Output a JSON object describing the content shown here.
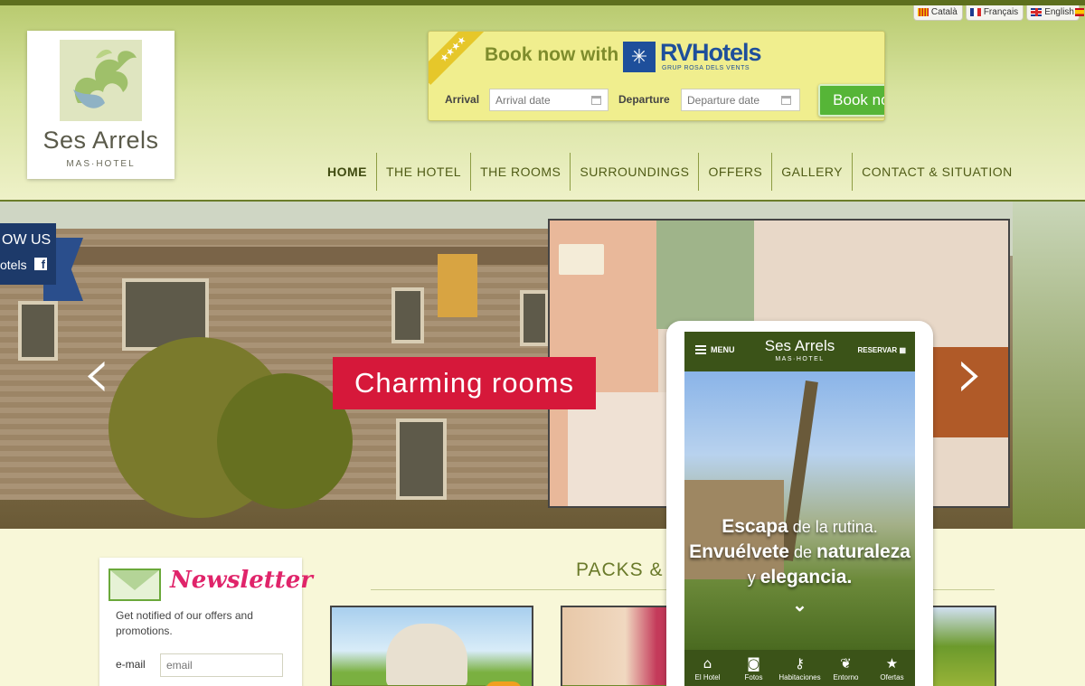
{
  "languages": [
    {
      "label": "Català",
      "flag": "ca"
    },
    {
      "label": "Français",
      "flag": "fr"
    },
    {
      "label": "English",
      "flag": "en"
    }
  ],
  "logo": {
    "name": "Ses Arrels",
    "subtitle": "MAS·HOTEL"
  },
  "booking": {
    "ribbon_stars": "★★★★",
    "title": "Book now with",
    "brand": "RVHotels",
    "brand_tagline": "GRUP ROSA DELS VENTS",
    "arrival_label": "Arrival",
    "arrival_placeholder": "Arrival date",
    "departure_label": "Departure",
    "departure_placeholder": "Departure date",
    "button": "Book now"
  },
  "nav": {
    "items": [
      {
        "label": "HOME",
        "active": true
      },
      {
        "label": "THE HOTEL"
      },
      {
        "label": "THE ROOMS"
      },
      {
        "label": "SURROUNDINGS"
      },
      {
        "label": "OFFERS"
      },
      {
        "label": "GALLERY"
      },
      {
        "label": "CONTACT & SITUATION"
      }
    ]
  },
  "hero": {
    "caption": "Charming rooms",
    "prev": "‹",
    "next": "›",
    "follow_line1": "OW US",
    "follow_line2": "otels",
    "follow_icon": "f"
  },
  "phone": {
    "menu": "MENU",
    "logo": "Ses Arrels",
    "logo_sub": "MAS·HOTEL",
    "reserve": "RESERVAR",
    "headline_a_bold": "Escapa",
    "headline_a_thin": " de la rutina.",
    "headline_b_bold": "Envuélvete",
    "headline_b_thin": " de ",
    "headline_b_bold2": "naturaleza",
    "headline_c_thin": "y ",
    "headline_c_bold": "elegancia.",
    "down": "⌄",
    "tabs": [
      {
        "label": "El Hotel",
        "icon": "⌂"
      },
      {
        "label": "Fotos",
        "icon": "◙"
      },
      {
        "label": "Habitaciones",
        "icon": "⚷"
      },
      {
        "label": "Entorno",
        "icon": "❦"
      },
      {
        "label": "Ofertas",
        "icon": "★"
      }
    ]
  },
  "newsletter": {
    "title": "Newsletter",
    "text": "Get notified of our offers and promotions.",
    "email_label": "e-mail",
    "email_placeholder": "email"
  },
  "packs": {
    "title": "PACKS &"
  },
  "colors": {
    "accent_green": "#56b537",
    "nav_text": "#505c16",
    "caption_red": "#d6183a",
    "newsletter_pink": "#e0246a"
  }
}
